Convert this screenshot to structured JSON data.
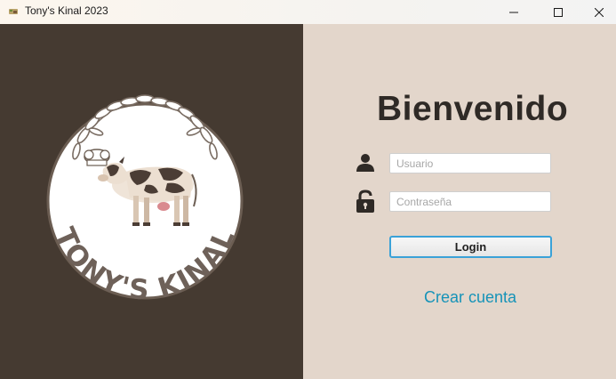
{
  "window": {
    "title": "Tony's Kinal 2023",
    "controls": [
      "minimize-icon",
      "maximize-icon",
      "close-icon"
    ]
  },
  "logo": {
    "text": "TONY'S KINAL"
  },
  "login": {
    "heading": "Bienvenido",
    "username": {
      "placeholder": "Usuario",
      "value": "",
      "icon": "user-icon"
    },
    "password": {
      "placeholder": "Contraseña",
      "value": "",
      "icon": "lock-icon"
    },
    "button_label": "Login",
    "create_account_label": "Crear cuenta"
  },
  "colors": {
    "left_panel": "#453a31",
    "right_panel": "#e3d6cb",
    "link": "#1693b8",
    "focus_border": "#3aa2d8"
  }
}
